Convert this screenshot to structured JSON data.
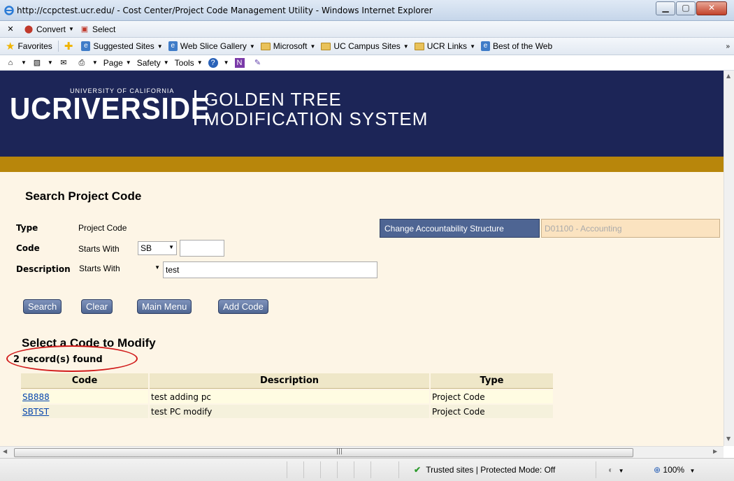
{
  "window": {
    "title": "http://ccpctest.ucr.edu/ - Cost Center/Project Code Management Utility - Windows Internet Explorer"
  },
  "toolbar1": {
    "convert_label": "Convert",
    "select_label": "Select"
  },
  "favorites_bar": {
    "favorites_label": "Favorites",
    "items": [
      "Suggested Sites",
      "Web Slice Gallery",
      "Microsoft",
      "UC Campus Sites",
      "UCR Links",
      "Best of the Web"
    ]
  },
  "command_bar": {
    "page_label": "Page",
    "safety_label": "Safety",
    "tools_label": "Tools"
  },
  "banner": {
    "logo_text": "UCRIVERSIDE",
    "university_text": "UNIVERSITY OF CALIFORNIA",
    "system_line1": "GOLDEN TREE",
    "system_line2": "MODIFICATION SYSTEM"
  },
  "search": {
    "heading": "Search Project Code",
    "type_label": "Type",
    "type_value": "Project Code",
    "code_label": "Code",
    "code_operator_prefix": "Starts With",
    "code_prefix_value": "SB",
    "code_value": "",
    "description_label": "Description",
    "description_operator": "Starts With",
    "description_value": "test",
    "change_structure_label": "Change Accountability Structure",
    "structure_value": "D01100 - Accounting"
  },
  "buttons": {
    "search": "Search",
    "clear": "Clear",
    "main_menu": "Main Menu",
    "add_code": "Add Code"
  },
  "results": {
    "heading": "Select a Code to Modify",
    "count_text": "2 record(s) found",
    "columns": [
      "Code",
      "Description",
      "Type"
    ],
    "rows": [
      {
        "code": "SB888",
        "description": "test adding pc",
        "type": "Project Code"
      },
      {
        "code": "SBTST",
        "description": "test PC modify",
        "type": "Project Code"
      }
    ]
  },
  "status": {
    "zone_text": "Trusted sites | Protected Mode: Off",
    "zoom_text": "100%"
  }
}
